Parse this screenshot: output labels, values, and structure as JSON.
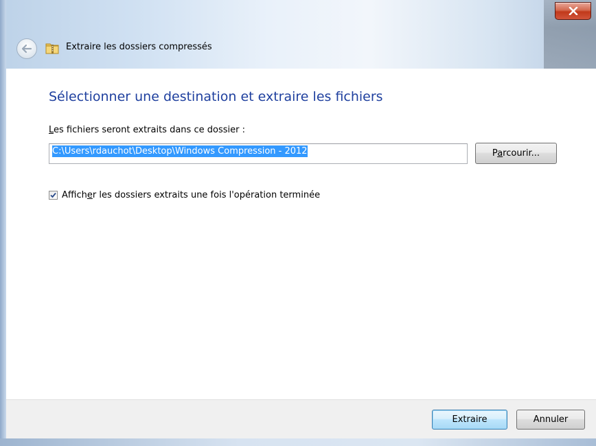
{
  "window": {
    "title": "Extraire les dossiers compressés",
    "close_icon": "close-icon"
  },
  "main": {
    "heading": "Sélectionner une destination et extraire les fichiers",
    "field_label": "Les fichiers seront extraits dans ce dossier :",
    "destination_path": "C:\\Users\\rdauchot\\Desktop\\Windows Compression - 2012",
    "browse_button": "Parcourir...",
    "show_folders_checkbox": {
      "label": "Afficher les dossiers extraits une fois l'opération terminée",
      "checked": true
    }
  },
  "footer": {
    "extract_button": "Extraire",
    "cancel_button": "Annuler"
  },
  "colors": {
    "heading": "#1e3f9e",
    "selection": "#3399ff",
    "close_button": "#c1391b"
  }
}
